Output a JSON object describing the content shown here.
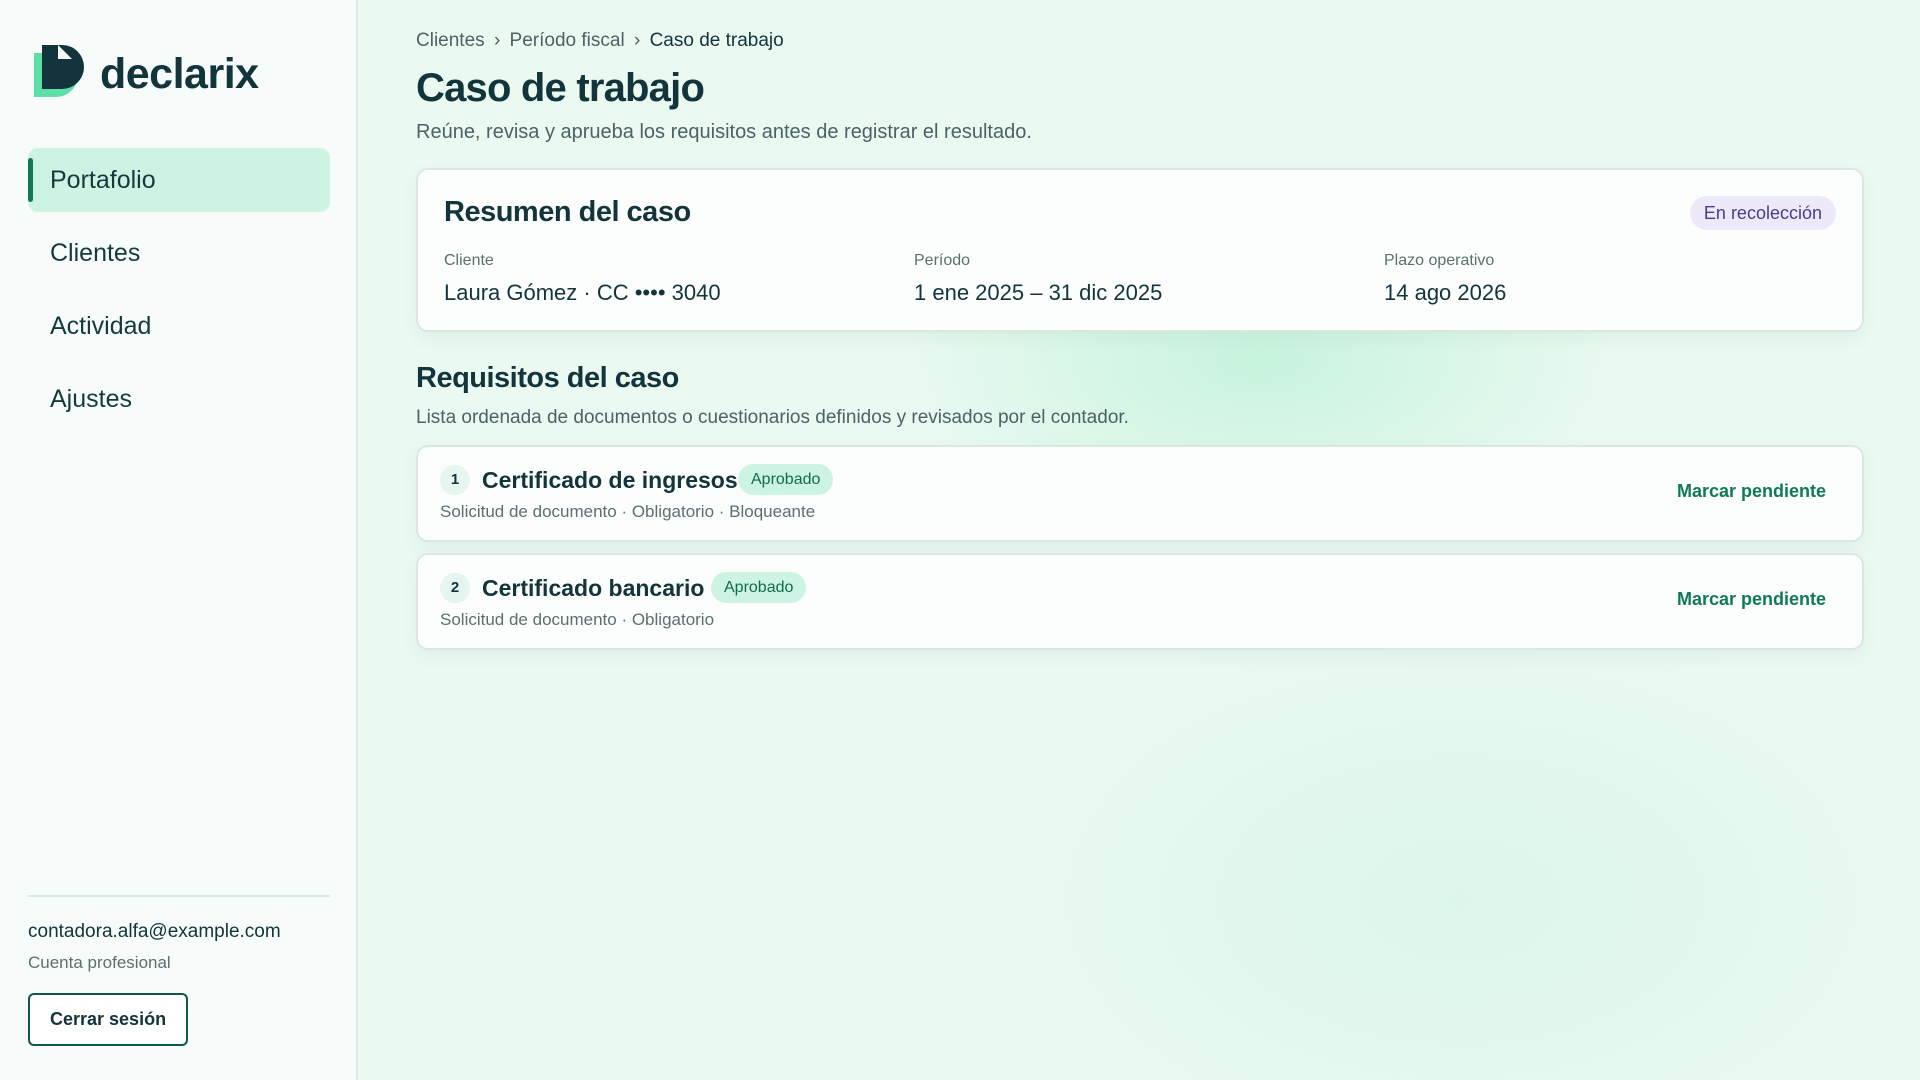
{
  "brand": {
    "name": "declarix",
    "accent": "#0f7a55"
  },
  "sidebar": {
    "items": [
      {
        "label": "Portafolio",
        "active": true
      },
      {
        "label": "Clientes",
        "active": false
      },
      {
        "label": "Actividad",
        "active": false
      },
      {
        "label": "Ajustes",
        "active": false
      }
    ],
    "account": {
      "email": "contadora.alfa@example.com",
      "type": "Cuenta profesional",
      "logout_label": "Cerrar sesión"
    }
  },
  "breadcrumb": {
    "items": [
      "Clientes",
      "Período fiscal"
    ],
    "separator": "›",
    "current": "Caso de trabajo"
  },
  "header": {
    "title": "Caso de trabajo",
    "subtitle": "Reúne, revisa y aprueba los requisitos antes de registrar el resultado."
  },
  "summary": {
    "title": "Resumen del caso",
    "status": "En recolección",
    "fields": [
      {
        "label": "Cliente",
        "value": "Laura Gómez · CC •••• 3040"
      },
      {
        "label": "Período",
        "value": "1 ene 2025 – 31 dic 2025"
      },
      {
        "label": "Plazo operativo",
        "value": "14 ago 2026"
      }
    ]
  },
  "requirements": {
    "title": "Requisitos del caso",
    "subtitle": "Lista ordenada de documentos o cuestionarios definidos y revisados por el contador.",
    "items": [
      {
        "number": "1",
        "name": "Certificado de ingresos",
        "status": "Aprobado",
        "meta": "Solicitud de documento · Obligatorio · Bloqueante",
        "action": "Marcar pendiente"
      },
      {
        "number": "2",
        "name": "Certificado bancario",
        "status": "Aprobado",
        "meta": "Solicitud de documento · Obligatorio",
        "action": "Marcar pendiente"
      }
    ]
  }
}
